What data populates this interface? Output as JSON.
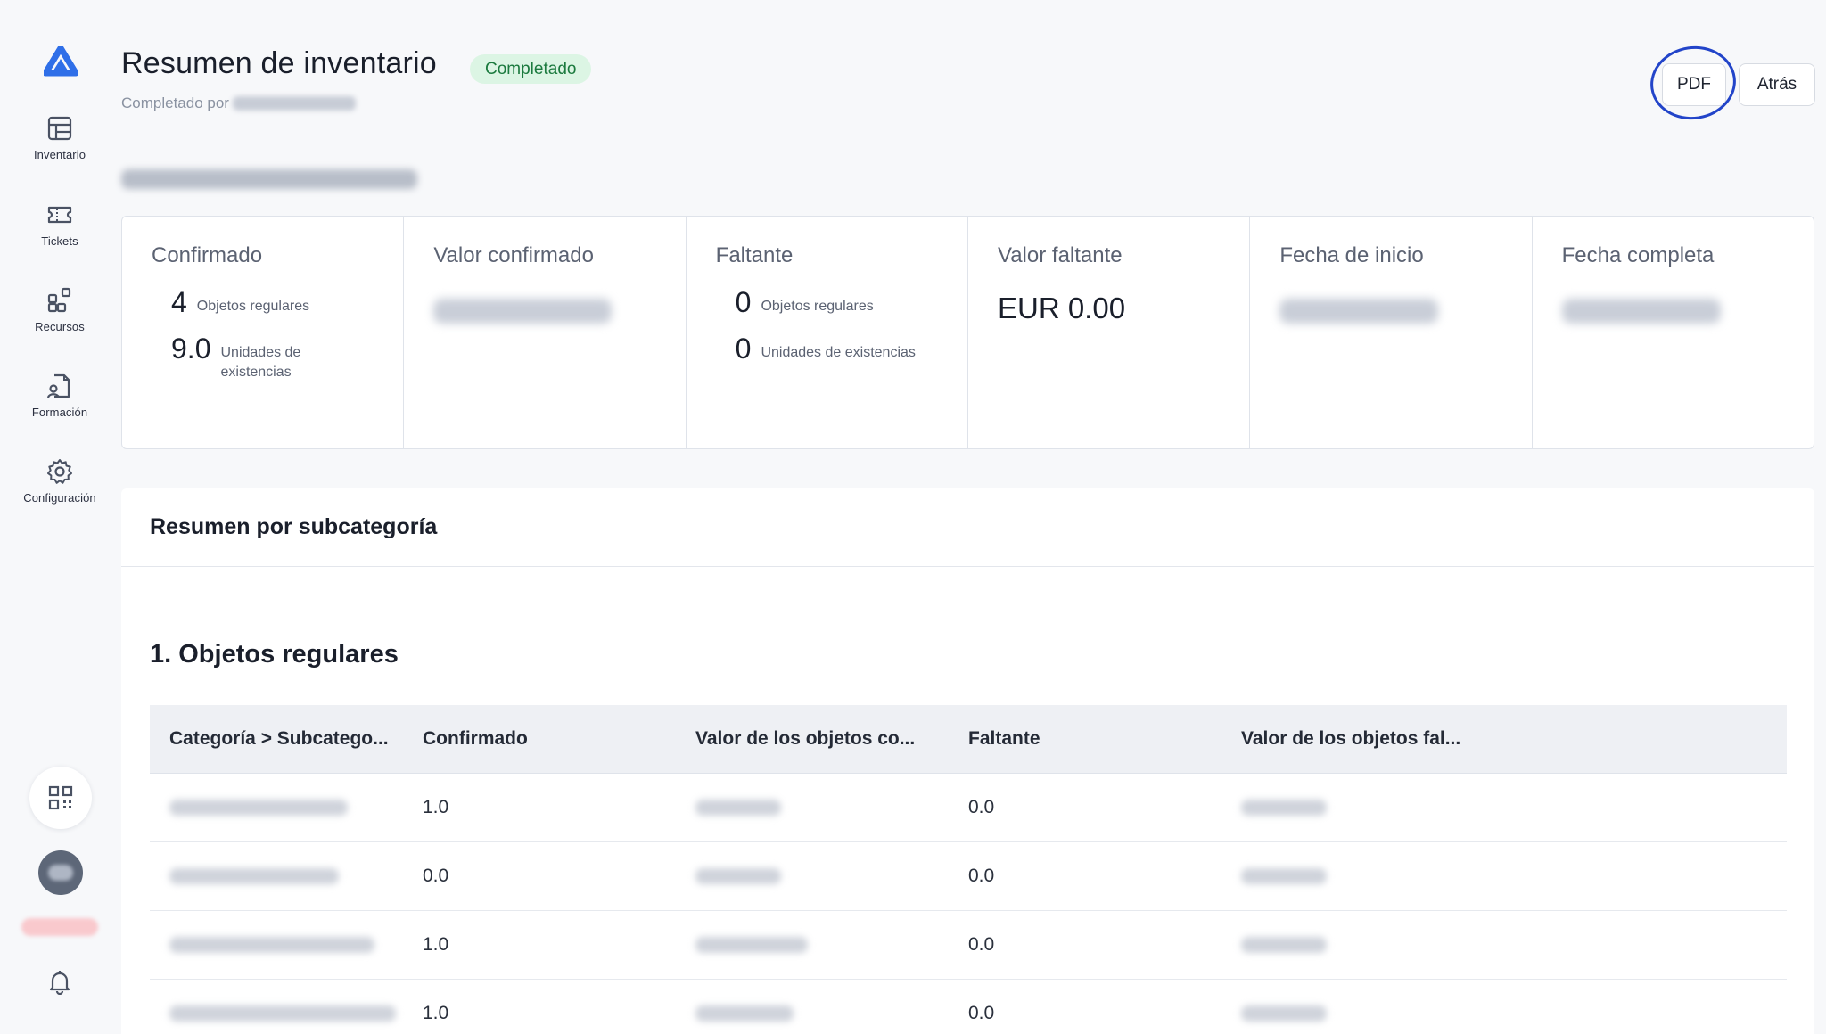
{
  "sidebar": {
    "items": [
      {
        "label": "Inventario",
        "icon": "table-icon"
      },
      {
        "label": "Tickets",
        "icon": "ticket-icon"
      },
      {
        "label": "Recursos",
        "icon": "resources-icon"
      },
      {
        "label": "Formación",
        "icon": "training-icon"
      },
      {
        "label": "Configuración",
        "icon": "gear-icon"
      }
    ]
  },
  "header": {
    "title": "Resumen de inventario",
    "status": "Completado",
    "completed_by_label": "Completado por",
    "pdf_label": "PDF",
    "back_label": "Atrás"
  },
  "stats": {
    "confirmed": {
      "title": "Confirmado",
      "regular_count": "4",
      "regular_label": "Objetos regulares",
      "stock_count": "9.0",
      "stock_label": "Unidades de existencias"
    },
    "confirmed_value": {
      "title": "Valor confirmado"
    },
    "missing": {
      "title": "Faltante",
      "regular_count": "0",
      "regular_label": "Objetos regulares",
      "stock_count": "0",
      "stock_label": "Unidades de existencias"
    },
    "missing_value": {
      "title": "Valor faltante",
      "value": "EUR 0.00"
    },
    "start_date": {
      "title": "Fecha de inicio"
    },
    "end_date": {
      "title": "Fecha completa"
    }
  },
  "panel": {
    "title": "Resumen por subcategoría",
    "section_title": "1. Objetos regulares",
    "columns": [
      "Categoría > Subcatego...",
      "Confirmado",
      "Valor de los objetos co...",
      "Faltante",
      "Valor de los objetos fal..."
    ],
    "rows": [
      {
        "confirmed": "1.0",
        "missing": "0.0"
      },
      {
        "confirmed": "0.0",
        "missing": "0.0"
      },
      {
        "confirmed": "1.0",
        "missing": "0.0"
      },
      {
        "confirmed": "1.0",
        "missing": "0.0"
      }
    ]
  },
  "colors": {
    "accent": "#2244c9",
    "status_bg": "#dcf5e4",
    "status_text": "#1b7a3e"
  }
}
